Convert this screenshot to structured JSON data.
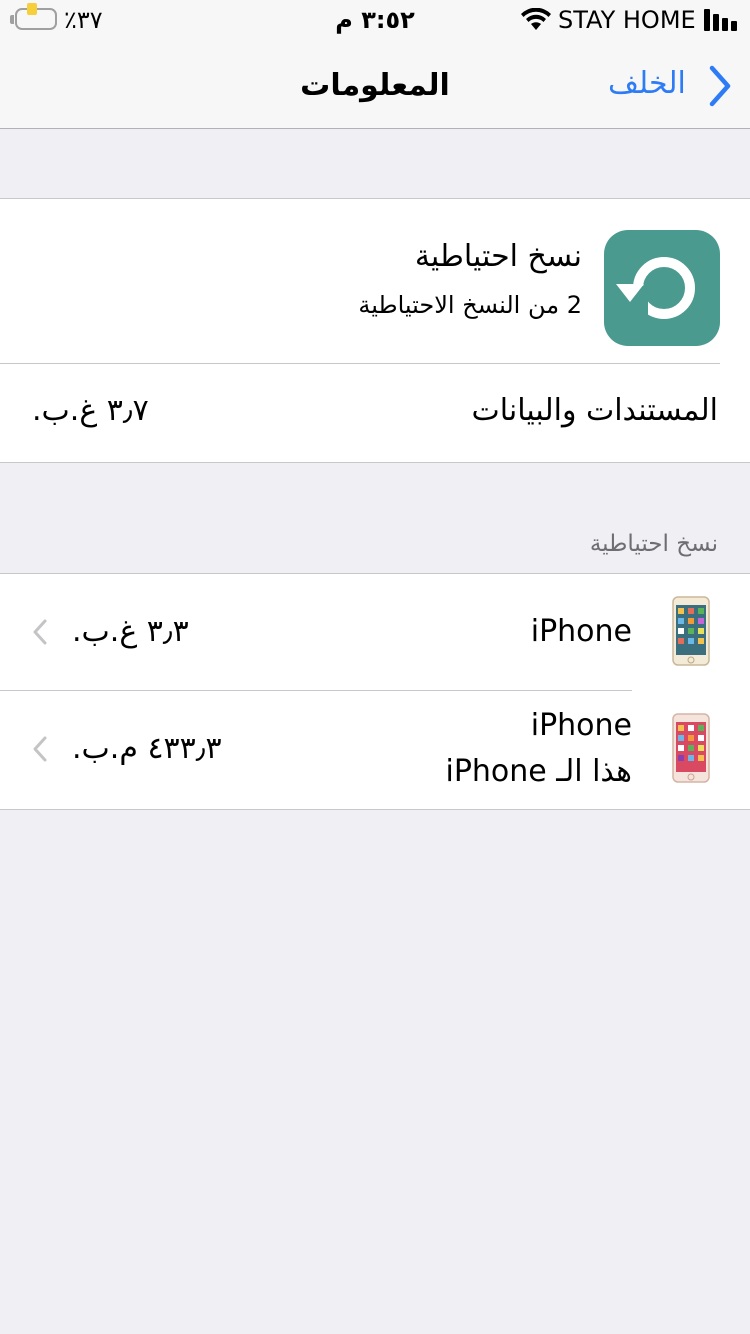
{
  "status_bar": {
    "battery_percent": "٪٣٧",
    "time": "٣:٥٢ م",
    "carrier": "STAY HOME",
    "battery_level": 0.37,
    "colors": {
      "battery_fill": "#f7cf3b"
    }
  },
  "nav": {
    "title": "المعلومات",
    "back_label": "الخلف",
    "colors": {
      "accent": "#2d7cf6"
    }
  },
  "app_info": {
    "name": "نسخ احتياطية",
    "subtitle": "2 من النسخ الاحتياطية",
    "icon": "backup-restore-icon",
    "colors": {
      "icon_bg": "#4a9a8f"
    }
  },
  "documents_row": {
    "label": "المستندات والبيانات",
    "value": "٣٫٧ غ.ب."
  },
  "backups_section": {
    "header": "نسخ احتياطية",
    "items": [
      {
        "name": "iPhone",
        "subtitle": "",
        "size": "٣٫٣ غ.ب.",
        "icon": "iphone-device-icon"
      },
      {
        "name": "iPhone",
        "subtitle": "هذا الـ iPhone",
        "size": "٤٣٣٫٣ م.ب.",
        "icon": "iphone-device-icon"
      }
    ]
  }
}
